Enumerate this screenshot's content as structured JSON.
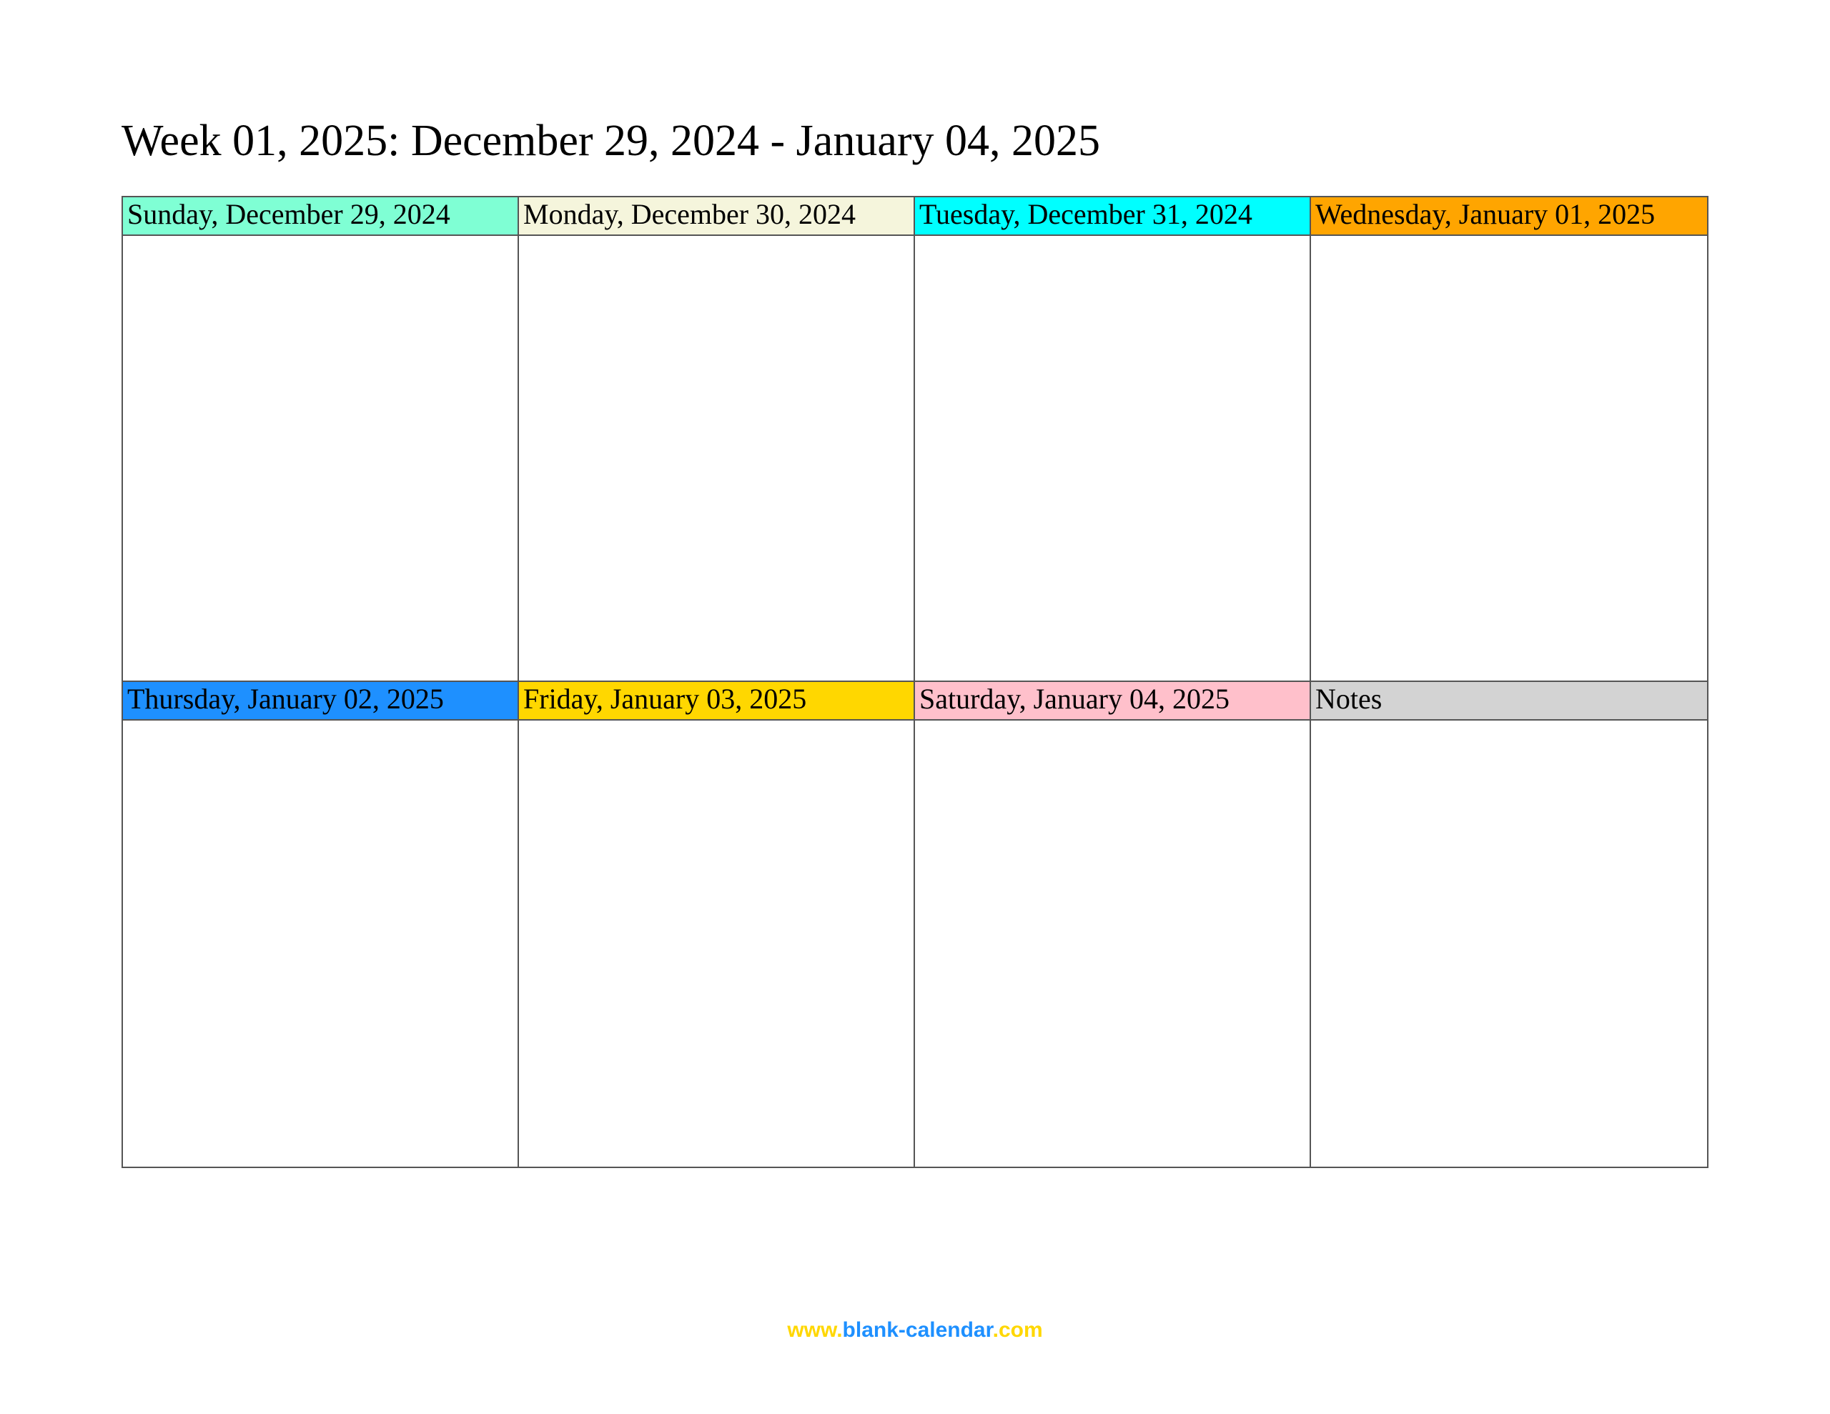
{
  "title": "Week 01, 2025: December 29, 2024 - January 04, 2025",
  "days": {
    "sun": {
      "label": "Sunday, December 29, 2024",
      "color": "#7FFFD4"
    },
    "mon": {
      "label": "Monday, December 30, 2024",
      "color": "#F5F5DC"
    },
    "tue": {
      "label": "Tuesday, December 31, 2024",
      "color": "#00FFFF"
    },
    "wed": {
      "label": "Wednesday, January 01, 2025",
      "color": "#FFA500"
    },
    "thu": {
      "label": "Thursday, January 02, 2025",
      "color": "#1E90FF"
    },
    "fri": {
      "label": "Friday, January 03, 2025",
      "color": "#FFD700"
    },
    "sat": {
      "label": "Saturday, January 04, 2025",
      "color": "#FFC0CB"
    },
    "notes": {
      "label": "Notes",
      "color": "#D3D3D3"
    }
  },
  "footer": {
    "part1": "www.",
    "part2": "blank-calendar",
    "part3": ".com"
  }
}
